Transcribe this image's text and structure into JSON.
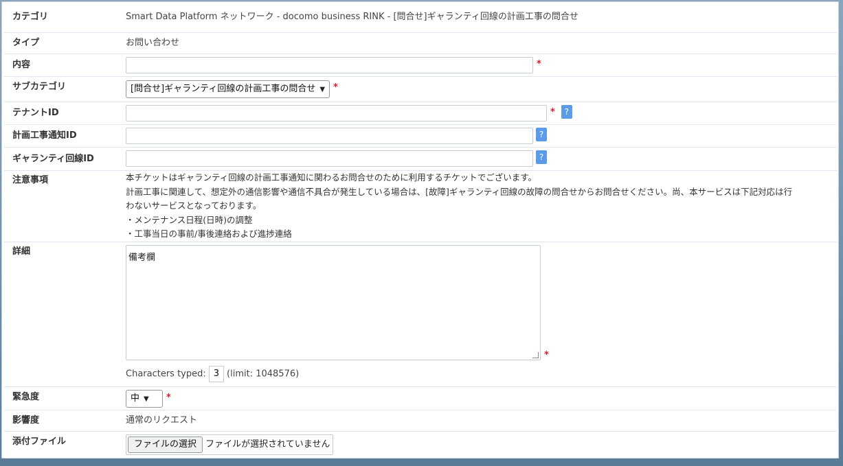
{
  "form": {
    "category": {
      "label": "カテゴリ",
      "value": "Smart Data Platform ネットワーク - docomo business RINK - [問合せ]ギャランティ回線の計画工事の問合せ"
    },
    "type": {
      "label": "タイプ",
      "value": "お問い合わせ"
    },
    "content": {
      "label": "内容",
      "value": "",
      "required": "*"
    },
    "subcategory": {
      "label": "サブカテゴリ",
      "selected": "[問合せ]ギャランティ回線の計画工事の問合せ",
      "required": "*"
    },
    "tenant_id": {
      "label": "テナントID",
      "value": "",
      "required": "*",
      "help": "?"
    },
    "plan_notice_id": {
      "label": "計画工事通知ID",
      "value": "",
      "help": "?"
    },
    "guarantee_line_id": {
      "label": "ギャランティ回線ID",
      "value": "",
      "help": "?"
    },
    "notes": {
      "label": "注意事項",
      "lines": [
        "本チケットはギャランティ回線の計画工事通知に関わるお問合せのために利用するチケットでございます。",
        "計画工事に関連して、想定外の通信影響や通信不具合が発生している場合は、[故障]ギャランティ回線の故障の問合せからお問合せください。尚、本サービスは下記対応は行",
        "わないサービスとなっております。",
        "・メンテナンス日程(日時)の調整",
        "・工事当日の事前/事後連絡および進捗連絡"
      ]
    },
    "details": {
      "label": "詳細",
      "value": "備考欄",
      "required": "*",
      "counter_prefix": "Characters typed:",
      "counter_value": "3",
      "counter_suffix": "(limit: 1048576)"
    },
    "urgency": {
      "label": "緊急度",
      "selected": "中",
      "required": "*"
    },
    "impact": {
      "label": "影響度",
      "value": "通常のリクエスト"
    },
    "attachment": {
      "label": "添付ファイル",
      "button": "ファイルの選択",
      "status": "ファイルが選択されていません"
    }
  },
  "colors": {
    "required": "#e0192c",
    "help_bg": "#5b9bea",
    "divider": "#dde6ee"
  },
  "icons": {
    "help": "question-icon",
    "dropdown": "chevron-down-icon",
    "resize": "resize-grip-icon"
  }
}
